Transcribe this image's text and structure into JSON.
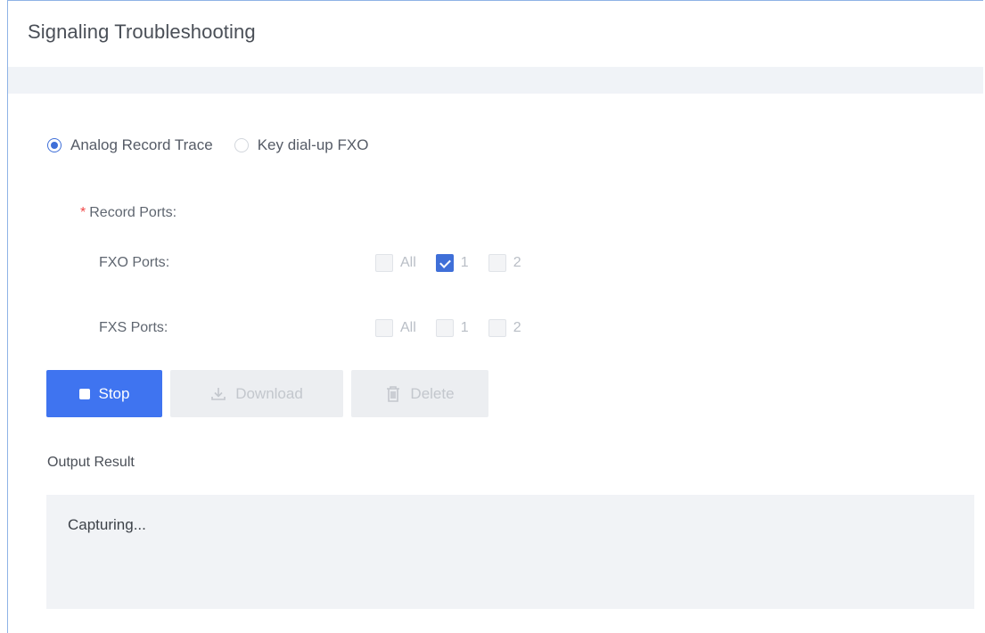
{
  "panel": {
    "title": "Signaling Troubleshooting"
  },
  "mode": {
    "options": [
      {
        "label": "Analog Record Trace",
        "checked": true
      },
      {
        "label": "Key dial-up FXO",
        "checked": false
      }
    ]
  },
  "record_ports": {
    "label": "Record Ports",
    "required_mark": "*",
    "separator": ":",
    "fxo": {
      "label": "FXO Ports",
      "options": [
        {
          "label": "All",
          "checked": false
        },
        {
          "label": "1",
          "checked": true
        },
        {
          "label": "2",
          "checked": false
        }
      ]
    },
    "fxs": {
      "label": "FXS Ports",
      "options": [
        {
          "label": "All",
          "checked": false
        },
        {
          "label": "1",
          "checked": false
        },
        {
          "label": "2",
          "checked": false
        }
      ]
    }
  },
  "actions": {
    "stop_label": "Stop",
    "download_label": "Download",
    "delete_label": "Delete"
  },
  "output": {
    "label": "Output Result",
    "text": "Capturing..."
  },
  "colors": {
    "accent": "#3f74f0",
    "checked": "#3f6fd8",
    "required": "#f04848"
  }
}
